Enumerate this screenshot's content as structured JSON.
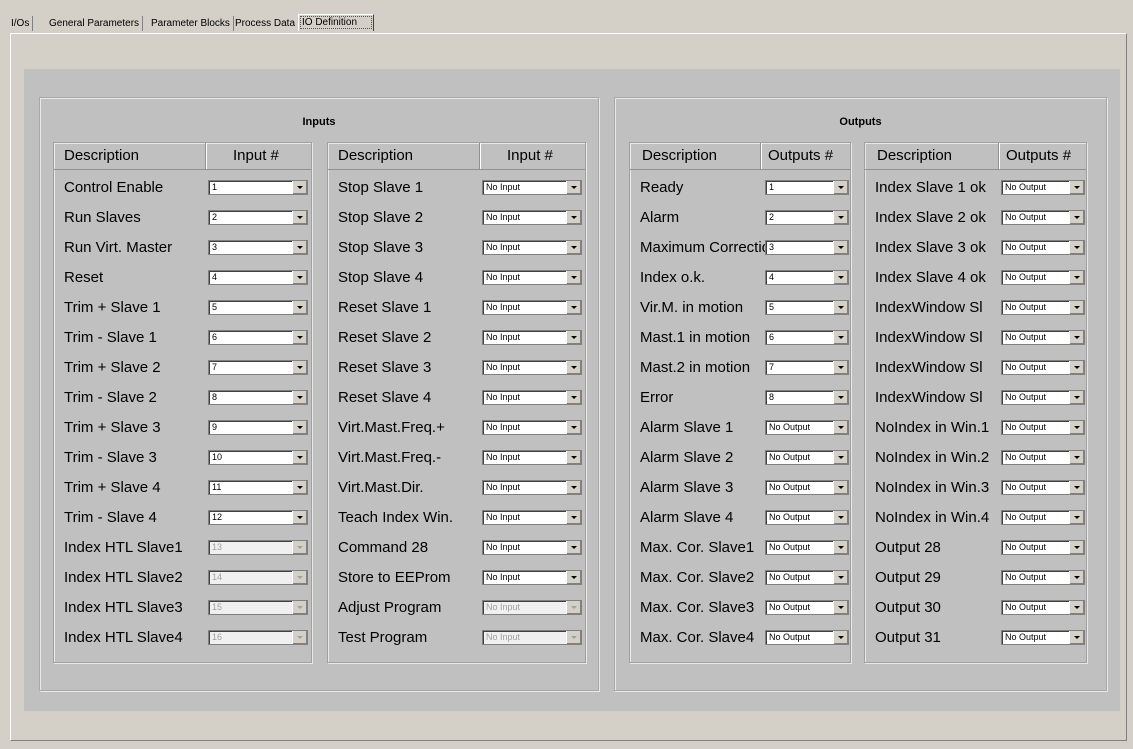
{
  "tabs": [
    "I/Os",
    "General Parameters",
    "Parameter Blocks",
    "Process Data",
    "IO Definition"
  ],
  "inputs": {
    "title": "Inputs",
    "header_desc": "Description",
    "header_num": "Input #",
    "col1": [
      {
        "label": "Control Enable",
        "value": "1",
        "disabled": false
      },
      {
        "label": "Run Slaves",
        "value": "2",
        "disabled": false
      },
      {
        "label": "Run Virt. Master",
        "value": "3",
        "disabled": false
      },
      {
        "label": "Reset",
        "value": "4",
        "disabled": false
      },
      {
        "label": "Trim + Slave 1",
        "value": "5",
        "disabled": false
      },
      {
        "label": "Trim - Slave 1",
        "value": "6",
        "disabled": false
      },
      {
        "label": "Trim + Slave 2",
        "value": "7",
        "disabled": false
      },
      {
        "label": "Trim - Slave 2",
        "value": "8",
        "disabled": false
      },
      {
        "label": "Trim + Slave 3",
        "value": "9",
        "disabled": false
      },
      {
        "label": "Trim - Slave 3",
        "value": "10",
        "disabled": false
      },
      {
        "label": "Trim + Slave 4",
        "value": "11",
        "disabled": false
      },
      {
        "label": "Trim - Slave 4",
        "value": "12",
        "disabled": false
      },
      {
        "label": "Index HTL Slave1",
        "value": "13",
        "disabled": true
      },
      {
        "label": "Index HTL Slave2",
        "value": "14",
        "disabled": true
      },
      {
        "label": "Index HTL Slave3",
        "value": "15",
        "disabled": true
      },
      {
        "label": "Index HTL Slave4",
        "value": "16",
        "disabled": true
      }
    ],
    "col2": [
      {
        "label": "Stop Slave 1",
        "value": "No Input",
        "disabled": false
      },
      {
        "label": "Stop Slave 2",
        "value": "No Input",
        "disabled": false
      },
      {
        "label": "Stop Slave 3",
        "value": "No Input",
        "disabled": false
      },
      {
        "label": "Stop Slave 4",
        "value": "No Input",
        "disabled": false
      },
      {
        "label": "Reset Slave 1",
        "value": "No Input",
        "disabled": false
      },
      {
        "label": "Reset Slave 2",
        "value": "No Input",
        "disabled": false
      },
      {
        "label": "Reset Slave 3",
        "value": "No Input",
        "disabled": false
      },
      {
        "label": "Reset Slave 4",
        "value": "No Input",
        "disabled": false
      },
      {
        "label": "Virt.Mast.Freq.+",
        "value": "No Input",
        "disabled": false
      },
      {
        "label": "Virt.Mast.Freq.-",
        "value": "No Input",
        "disabled": false
      },
      {
        "label": "Virt.Mast.Dir.",
        "value": "No Input",
        "disabled": false
      },
      {
        "label": "Teach Index Win.",
        "value": "No Input",
        "disabled": false
      },
      {
        "label": "Command 28",
        "value": "No Input",
        "disabled": false
      },
      {
        "label": "Store to EEProm",
        "value": "No Input",
        "disabled": false
      },
      {
        "label": "Adjust Program",
        "value": "No Input",
        "disabled": true
      },
      {
        "label": "Test Program",
        "value": "No Input",
        "disabled": true
      }
    ]
  },
  "outputs": {
    "title": "Outputs",
    "header_desc": "Description",
    "header_num": "Outputs #",
    "col1": [
      {
        "label": "Ready",
        "value": "1",
        "disabled": false
      },
      {
        "label": "Alarm",
        "value": "2",
        "disabled": false
      },
      {
        "label": "Maximum Correction",
        "value": "3",
        "disabled": false
      },
      {
        "label": "Index o.k.",
        "value": "4",
        "disabled": false
      },
      {
        "label": "Vir.M. in motion",
        "value": "5",
        "disabled": false
      },
      {
        "label": "Mast.1 in motion",
        "value": "6",
        "disabled": false
      },
      {
        "label": "Mast.2 in motion",
        "value": "7",
        "disabled": false
      },
      {
        "label": "Error",
        "value": "8",
        "disabled": false
      },
      {
        "label": "Alarm Slave 1",
        "value": "No Output",
        "disabled": false
      },
      {
        "label": "Alarm Slave 2",
        "value": "No Output",
        "disabled": false
      },
      {
        "label": "Alarm Slave 3",
        "value": "No Output",
        "disabled": false
      },
      {
        "label": "Alarm Slave 4",
        "value": "No Output",
        "disabled": false
      },
      {
        "label": "Max. Cor. Slave1",
        "value": "No Output",
        "disabled": false
      },
      {
        "label": "Max. Cor. Slave2",
        "value": "No Output",
        "disabled": false
      },
      {
        "label": "Max. Cor. Slave3",
        "value": "No Output",
        "disabled": false
      },
      {
        "label": "Max. Cor. Slave4",
        "value": "No Output",
        "disabled": false
      }
    ],
    "col2": [
      {
        "label": "Index Slave 1 ok",
        "value": "No Output",
        "disabled": false
      },
      {
        "label": "Index Slave 2 ok",
        "value": "No Output",
        "disabled": false
      },
      {
        "label": "Index Slave 3 ok",
        "value": "No Output",
        "disabled": false
      },
      {
        "label": "Index Slave 4 ok",
        "value": "No Output",
        "disabled": false
      },
      {
        "label": "IndexWindow Sl",
        "value": "No Output",
        "disabled": false
      },
      {
        "label": "IndexWindow Sl",
        "value": "No Output",
        "disabled": false
      },
      {
        "label": "IndexWindow Sl",
        "value": "No Output",
        "disabled": false
      },
      {
        "label": "IndexWindow Sl",
        "value": "No Output",
        "disabled": false
      },
      {
        "label": "NoIndex in Win.1",
        "value": "No Output",
        "disabled": false
      },
      {
        "label": "NoIndex in Win.2",
        "value": "No Output",
        "disabled": false
      },
      {
        "label": "NoIndex in Win.3",
        "value": "No Output",
        "disabled": false
      },
      {
        "label": "NoIndex in Win.4",
        "value": "No Output",
        "disabled": false
      },
      {
        "label": "Output 28",
        "value": "No Output",
        "disabled": false
      },
      {
        "label": "Output 29",
        "value": "No Output",
        "disabled": false
      },
      {
        "label": "Output 30",
        "value": "No Output",
        "disabled": false
      },
      {
        "label": "Output 31",
        "value": "No Output",
        "disabled": false
      }
    ]
  }
}
